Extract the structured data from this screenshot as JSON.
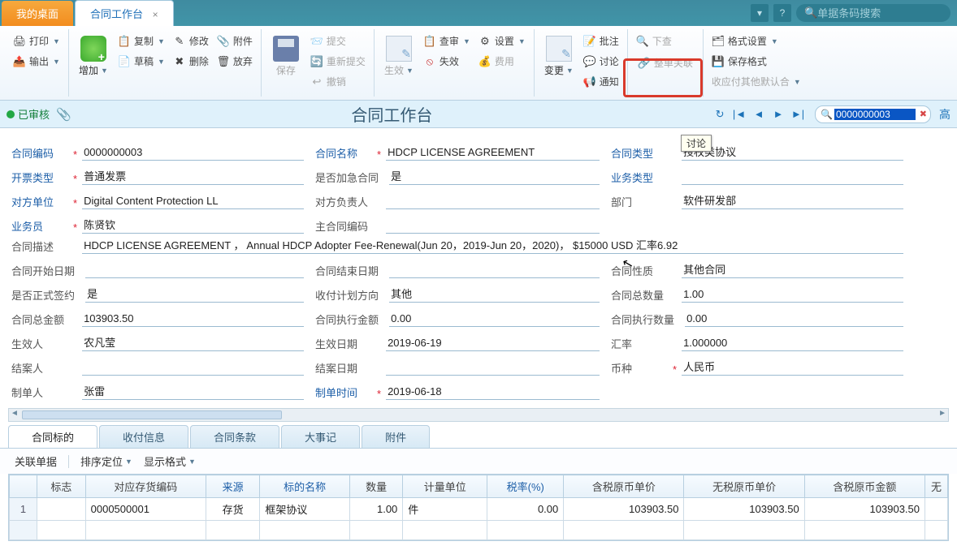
{
  "topbar": {
    "tabs": [
      {
        "label": "我的桌面"
      },
      {
        "label": "合同工作台"
      }
    ],
    "close_glyph": "×",
    "search_placeholder": "单据条码搜索"
  },
  "ribbon": {
    "print": "打印",
    "output": "输出",
    "add": "增加",
    "copy": "复制",
    "draft": "草稿",
    "modify": "修改",
    "delete": "删除",
    "attachment": "附件",
    "discard": "放弃",
    "save": "保存",
    "submit": "提交",
    "resubmit": "重新提交",
    "revoke": "撤销",
    "raw": "生效",
    "audit": "查审",
    "invalid": "失效",
    "settings": "设置",
    "fee": "费用",
    "change": "变更",
    "annotate": "批注",
    "discuss": "讨论",
    "notify": "通知",
    "down_check": "下查",
    "whole_link": "整单关联",
    "format_set": "格式设置",
    "save_format": "保存格式",
    "other_default": "收应付其他默认合"
  },
  "titlebar": {
    "status": "已审核",
    "title": "合同工作台",
    "search_value": "0000000003",
    "expand": "高"
  },
  "form": {
    "contract_code": {
      "label": "合同编码",
      "value": "0000000003"
    },
    "contract_name": {
      "label": "合同名称",
      "value": "HDCP LICENSE AGREEMENT"
    },
    "contract_type": {
      "label": "合同类型",
      "value": "授权类协议",
      "tooltip": "讨论"
    },
    "invoice_type": {
      "label": "开票类型",
      "value": "普通发票"
    },
    "rush": {
      "label": "是否加急合同",
      "value": "是"
    },
    "biz_type": {
      "label": "业务类型",
      "value": ""
    },
    "counterparty": {
      "label": "对方单位",
      "value": "Digital Content Protection LL"
    },
    "counter_manager": {
      "label": "对方负责人",
      "value": ""
    },
    "dept": {
      "label": "部门",
      "value": "软件研发部"
    },
    "salesman": {
      "label": "业务员",
      "value": "陈贤钦"
    },
    "main_code": {
      "label": "主合同编码",
      "value": ""
    },
    "desc": {
      "label": "合同描述",
      "value": "HDCP LICENSE AGREEMENT ， Annual HDCP Adopter Fee-Renewal(Jun 20，2019-Jun 20，2020)， $15000 USD 汇率6.92"
    },
    "start_date": {
      "label": "合同开始日期",
      "value": ""
    },
    "end_date": {
      "label": "合同结束日期",
      "value": ""
    },
    "nature": {
      "label": "合同性质",
      "value": "其他合同"
    },
    "formal": {
      "label": "是否正式签约",
      "value": "是"
    },
    "plan_dir": {
      "label": "收付计划方向",
      "value": "其他"
    },
    "total_qty": {
      "label": "合同总数量",
      "value": "1.00"
    },
    "total_amt": {
      "label": "合同总金额",
      "value": "103903.50"
    },
    "exec_amt": {
      "label": "合同执行金额",
      "value": "0.00"
    },
    "exec_qty": {
      "label": "合同执行数量",
      "value": "0.00"
    },
    "effector": {
      "label": "生效人",
      "value": "农凡莹"
    },
    "effect_date": {
      "label": "生效日期",
      "value": "2019-06-19"
    },
    "rate": {
      "label": "汇率",
      "value": "1.000000"
    },
    "closer": {
      "label": "结案人",
      "value": ""
    },
    "close_date": {
      "label": "结案日期",
      "value": ""
    },
    "currency": {
      "label": "币种",
      "value": "人民币"
    },
    "creator": {
      "label": "制单人",
      "value": "张雷"
    },
    "create_time": {
      "label": "制单时间",
      "value": "2019-06-18"
    }
  },
  "detail_tabs": [
    "合同标的",
    "收付信息",
    "合同条款",
    "大事记",
    "附件"
  ],
  "subbar": {
    "link_doc": "关联单据",
    "sort_pos": "排序定位",
    "display_fmt": "显示格式"
  },
  "table": {
    "headers": {
      "mark": "标志",
      "inv_code": "对应存货编码",
      "source": "来源",
      "subject_name": "标的名称",
      "qty": "数量",
      "unit": "计量单位",
      "tax_rate": "税率(%)",
      "tax_price": "含税原币单价",
      "notax_price": "无税原币单价",
      "tax_amount": "含税原币金额",
      "more": "无"
    },
    "rows": [
      {
        "idx": "1",
        "mark": "",
        "inv_code": "0000500001",
        "source": "存货",
        "subject_name": "框架协议",
        "qty": "1.00",
        "unit": "件",
        "tax_rate": "0.00",
        "tax_price": "103903.50",
        "notax_price": "103903.50",
        "tax_amount": "103903.50"
      }
    ]
  }
}
